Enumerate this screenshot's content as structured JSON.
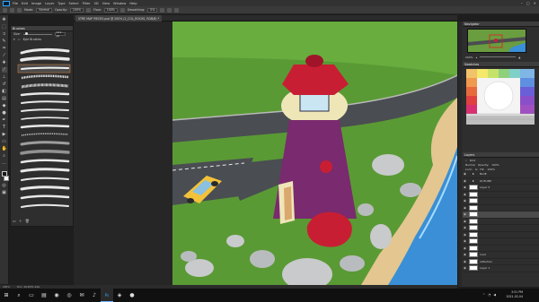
{
  "menubar": {
    "items": [
      "File",
      "Edit",
      "Image",
      "Layer",
      "Type",
      "Select",
      "Filter",
      "3D",
      "View",
      "Window",
      "Help"
    ],
    "window_controls": [
      "–",
      "□",
      "✕"
    ]
  },
  "options": {
    "mode_label": "Mode:",
    "mode_value": "Normal",
    "opacity_label": "Opacity:",
    "opacity_value": "100%",
    "flow_label": "Flow:",
    "flow_value": "100%",
    "smoothing_label": "Smoothing:",
    "smoothing_value": "0%"
  },
  "document": {
    "tab_title": "STRE MAP PIECES.psd @ 200% (2_COL_ROCKS, RGB/8) *"
  },
  "brushes": {
    "panel_title": "Brushes",
    "size_label": "Size:",
    "size_value": "111 px",
    "group_label": "Kyle Brushes",
    "numbers": [
      "",
      "",
      "",
      "",
      "",
      "",
      "",
      "",
      "",
      "",
      "",
      "",
      "",
      "",
      "",
      "",
      "",
      ""
    ]
  },
  "navigator": {
    "title": "Navigator",
    "zoom": "200%"
  },
  "swatches": {
    "title": "Swatches"
  },
  "layers": {
    "title": "Layers",
    "filter_kind": "Kind",
    "blend_mode": "Normal",
    "opacity_label": "Opacity:",
    "opacity_value": "100%",
    "lock_label": "Lock:",
    "fill_label": "Fill:",
    "fill_value": "100%",
    "rows": [
      {
        "name": "BLUE",
        "type": "folder",
        "selected": false
      },
      {
        "name": "OUTLINE",
        "type": "folder",
        "selected": false
      },
      {
        "name": "Layer 5",
        "type": "layer",
        "selected": false
      },
      {
        "name": "",
        "type": "layer",
        "selected": false
      },
      {
        "name": "",
        "type": "layer",
        "selected": false
      },
      {
        "name": "",
        "type": "layer",
        "selected": false
      },
      {
        "name": "",
        "type": "layer",
        "selected": true
      },
      {
        "name": "",
        "type": "layer",
        "selected": false
      },
      {
        "name": "",
        "type": "layer",
        "selected": false
      },
      {
        "name": "",
        "type": "layer",
        "selected": false
      },
      {
        "name": "",
        "type": "layer",
        "selected": false
      },
      {
        "name": "",
        "type": "layer",
        "selected": false
      },
      {
        "name": "road",
        "type": "layer",
        "selected": false
      },
      {
        "name": "reflection",
        "type": "layer",
        "selected": false
      },
      {
        "name": "Layer 1",
        "type": "layer",
        "selected": false
      }
    ]
  },
  "status": {
    "zoom": "200%",
    "doc": "Doc: 49.4M/1.44G"
  },
  "taskbar": {
    "time": "3:51 PM",
    "date": "2021-02-04"
  },
  "colors": {
    "accent": "#31a8ff",
    "grass": "#5a9a35",
    "road": "#4a4d52",
    "lighthouse_body": "#7a2a6e",
    "lighthouse_roof": "#c81e33",
    "water": "#3a8fd6",
    "sand": "#e3c690"
  }
}
